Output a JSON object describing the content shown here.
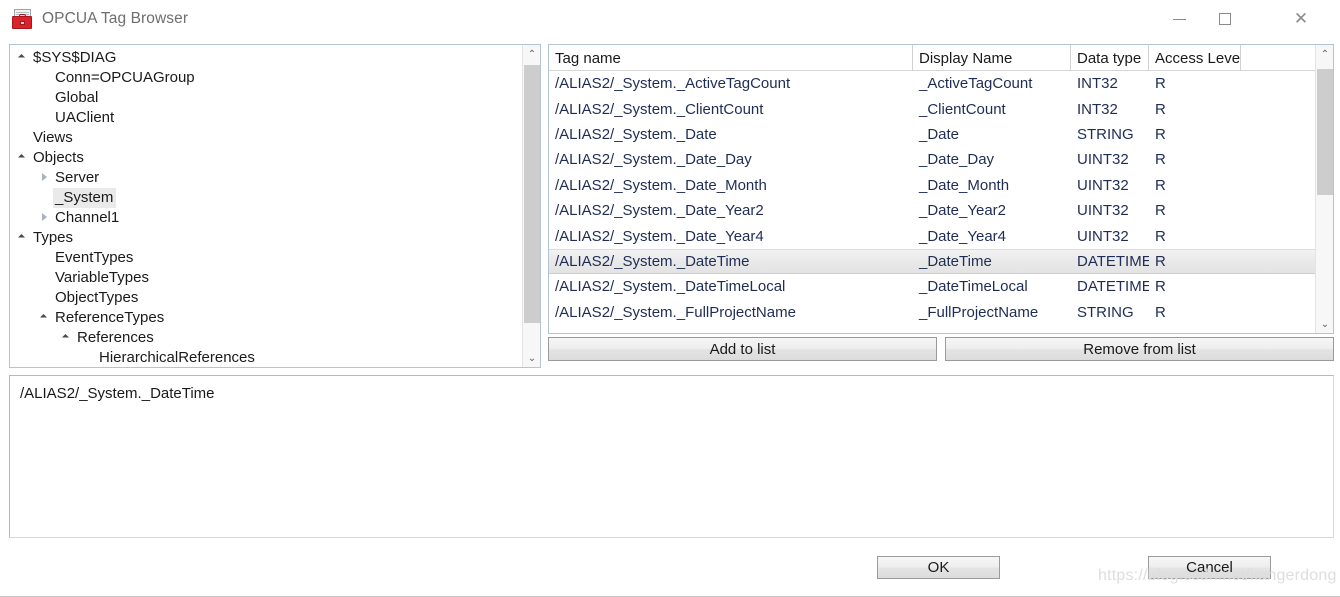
{
  "window": {
    "title": "OPCUA Tag Browser",
    "icon": "toolbox-icon",
    "controls": {
      "minimize": "—",
      "maximize": "□",
      "close": "✕"
    }
  },
  "tree": {
    "nodes": [
      {
        "label": "$SYS$DIAG",
        "depth": 0,
        "state": "expanded",
        "selected": false
      },
      {
        "label": "Conn=OPCUAGroup",
        "depth": 1,
        "state": "leaf",
        "selected": false
      },
      {
        "label": "Global",
        "depth": 1,
        "state": "leaf",
        "selected": false
      },
      {
        "label": "UAClient",
        "depth": 1,
        "state": "leaf",
        "selected": false
      },
      {
        "label": "Views",
        "depth": 0,
        "state": "leaf",
        "selected": false
      },
      {
        "label": "Objects",
        "depth": 0,
        "state": "expanded",
        "selected": false
      },
      {
        "label": "Server",
        "depth": 1,
        "state": "collapsed",
        "selected": false
      },
      {
        "label": "_System",
        "depth": 1,
        "state": "leaf",
        "selected": true
      },
      {
        "label": "Channel1",
        "depth": 1,
        "state": "collapsed",
        "selected": false
      },
      {
        "label": "Types",
        "depth": 0,
        "state": "expanded",
        "selected": false
      },
      {
        "label": "EventTypes",
        "depth": 1,
        "state": "leaf",
        "selected": false
      },
      {
        "label": "VariableTypes",
        "depth": 1,
        "state": "leaf",
        "selected": false
      },
      {
        "label": "ObjectTypes",
        "depth": 1,
        "state": "leaf",
        "selected": false
      },
      {
        "label": "ReferenceTypes",
        "depth": 1,
        "state": "expanded",
        "selected": false
      },
      {
        "label": "References",
        "depth": 2,
        "state": "expanded",
        "selected": false
      },
      {
        "label": "HierarchicalReferences",
        "depth": 3,
        "state": "leaf",
        "selected": false
      }
    ],
    "scrollbar": {
      "up_arrow": "⌃",
      "down_arrow": "⌄"
    }
  },
  "table": {
    "columns": [
      {
        "key": "tag",
        "label": "Tag name"
      },
      {
        "key": "disp",
        "label": "Display Name"
      },
      {
        "key": "type",
        "label": "Data type"
      },
      {
        "key": "access",
        "label": "Access Level"
      }
    ],
    "rows": [
      {
        "tag": "/ALIAS2/_System._ActiveTagCount",
        "disp": "_ActiveTagCount",
        "type": "INT32",
        "access": "R",
        "selected": false
      },
      {
        "tag": "/ALIAS2/_System._ClientCount",
        "disp": "_ClientCount",
        "type": "INT32",
        "access": "R",
        "selected": false
      },
      {
        "tag": "/ALIAS2/_System._Date",
        "disp": "_Date",
        "type": "STRING",
        "access": "R",
        "selected": false
      },
      {
        "tag": "/ALIAS2/_System._Date_Day",
        "disp": "_Date_Day",
        "type": "UINT32",
        "access": "R",
        "selected": false
      },
      {
        "tag": "/ALIAS2/_System._Date_Month",
        "disp": "_Date_Month",
        "type": "UINT32",
        "access": "R",
        "selected": false
      },
      {
        "tag": "/ALIAS2/_System._Date_Year2",
        "disp": "_Date_Year2",
        "type": "UINT32",
        "access": "R",
        "selected": false
      },
      {
        "tag": "/ALIAS2/_System._Date_Year4",
        "disp": "_Date_Year4",
        "type": "UINT32",
        "access": "R",
        "selected": false
      },
      {
        "tag": "/ALIAS2/_System._DateTime",
        "disp": "_DateTime",
        "type": "DATETIME",
        "access": "R",
        "selected": true
      },
      {
        "tag": "/ALIAS2/_System._DateTimeLocal",
        "disp": "_DateTimeLocal",
        "type": "DATETIME",
        "access": "R",
        "selected": false
      },
      {
        "tag": "/ALIAS2/_System._FullProjectName",
        "disp": "_FullProjectName",
        "type": "STRING",
        "access": "R",
        "selected": false
      }
    ],
    "scrollbar": {
      "up_arrow": "⌃",
      "down_arrow": "⌄"
    }
  },
  "list_actions": {
    "add_label": "Add to list",
    "remove_label": "Remove from list"
  },
  "selected_tags": {
    "value": "/ALIAS2/_System._DateTime"
  },
  "footer": {
    "ok_label": "OK",
    "cancel_label": "Cancel"
  },
  "watermark": {
    "text": "https://blog.csdn.net/kangerdong"
  }
}
